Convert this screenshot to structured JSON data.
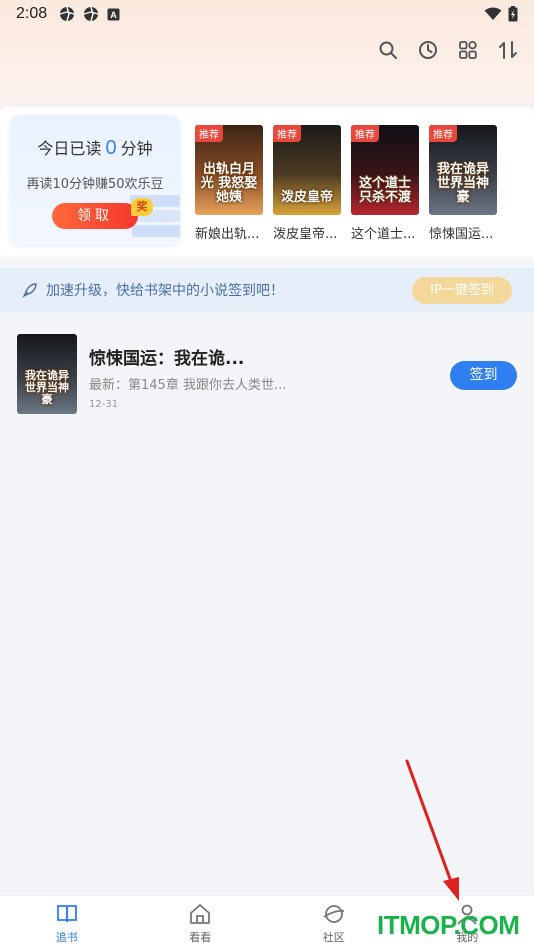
{
  "status_bar": {
    "time": "2:08",
    "icons": [
      "aperture-icon",
      "aperture-icon",
      "a-badge-icon"
    ],
    "right_icons": [
      "wifi-icon",
      "battery-icon"
    ]
  },
  "toolbar": {
    "icons": [
      "search-icon",
      "history-clock-icon",
      "grid-icon",
      "sort-icon"
    ]
  },
  "today_card": {
    "prefix": "今日已读",
    "minutes": "0",
    "suffix": "分钟",
    "subtitle": "再读10分钟赚50欢乐豆",
    "claim_label": "领取",
    "badge": "奖"
  },
  "recommended_books": [
    {
      "tag": "推荐",
      "title": "新娘出轨...",
      "cover_text": "出轨白月光 我怒娶她姨",
      "cover_colors": [
        "#6b3b1e",
        "#e6a15a"
      ]
    },
    {
      "tag": "推荐",
      "title": "泼皮皇帝...",
      "cover_text": "泼皮皇帝",
      "cover_colors": [
        "#2d2a26",
        "#d9a33a"
      ]
    },
    {
      "tag": "推荐",
      "title": "这个道士...",
      "cover_text": "这个道士 只杀不渡",
      "cover_colors": [
        "#1a1a1f",
        "#b8262f"
      ]
    },
    {
      "tag": "推荐",
      "title": "惊悚国运...",
      "cover_text": "我在诡异 世界当神豪",
      "cover_colors": [
        "#22252b",
        "#6c7684"
      ]
    }
  ],
  "banner": {
    "text": "加速升级，快给书架中的小说签到吧！",
    "button": "IP一键签到"
  },
  "shelf": [
    {
      "title": "惊悚国运：我在诡...",
      "latest": "最新：第145章 我跟你去人类世...",
      "date": "12-31",
      "action": "签到",
      "cover_text": "我在诡异 世界当神豪"
    }
  ],
  "bottom_nav": [
    {
      "label": "追书",
      "icon": "book-open-icon",
      "active": true
    },
    {
      "label": "看看",
      "icon": "home-icon",
      "active": false
    },
    {
      "label": "社区",
      "icon": "planet-icon",
      "active": false
    },
    {
      "label": "我的",
      "icon": "user-icon",
      "active": false
    }
  ],
  "watermark": "ITMOP.COM",
  "colors": {
    "accent": "#2f7ff0",
    "claim": "#f5362b",
    "tag": "#e8473b",
    "watermark": "#19b34a"
  }
}
